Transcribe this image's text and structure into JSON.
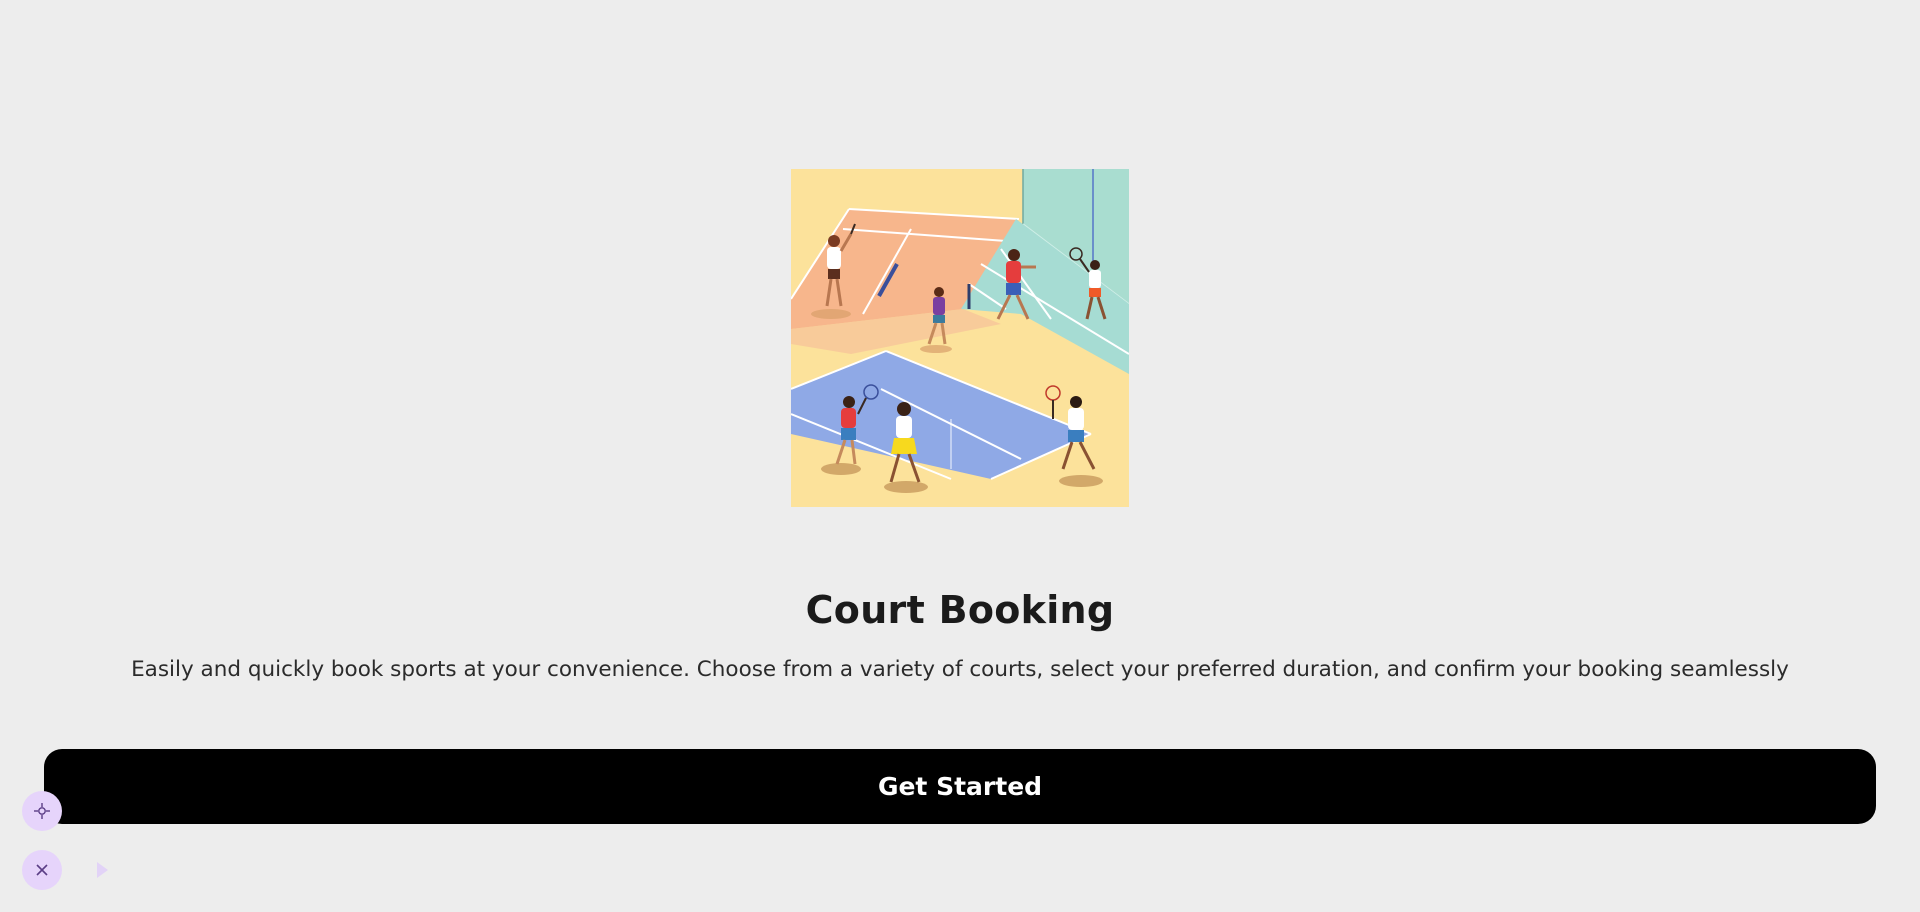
{
  "hero": {
    "illustration": "people-playing-tennis-on-courts"
  },
  "title": "Court Booking",
  "subtitle": "Easily and quickly book sports at your convenience. Choose from a variety of courts, select your preferred duration, and confirm your booking seamlessly",
  "cta": {
    "label": "Get Started"
  },
  "floating_controls": {
    "target_icon": "crosshair-icon",
    "close_icon": "close-icon",
    "play_icon": "play-icon"
  },
  "colors": {
    "background": "#ededed",
    "button_bg": "#000000",
    "button_text": "#ffffff",
    "fab_bg": "#e6d4fb",
    "fab_icon": "#5b3d86"
  }
}
